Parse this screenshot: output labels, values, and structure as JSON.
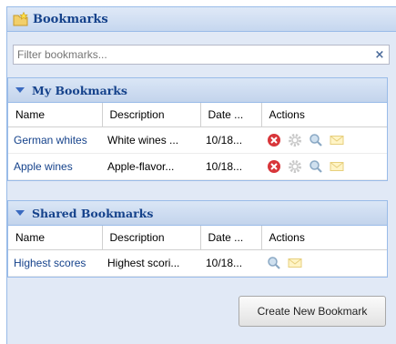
{
  "panel": {
    "title": "Bookmarks"
  },
  "filter": {
    "placeholder": "Filter bookmarks...",
    "value": "",
    "clear_label": "×"
  },
  "columns": {
    "name": "Name",
    "description": "Description",
    "date": "Date ...",
    "actions": "Actions"
  },
  "my_bookmarks": {
    "title": "My Bookmarks",
    "rows": [
      {
        "name": "German whites",
        "description": "White wines ...",
        "date": "10/18..."
      },
      {
        "name": "Apple wines",
        "description": "Apple-flavor...",
        "date": "10/18..."
      }
    ]
  },
  "shared_bookmarks": {
    "title": "Shared Bookmarks",
    "rows": [
      {
        "name": "Highest scores",
        "description": "Highest scori...",
        "date": "10/18..."
      }
    ]
  },
  "create_button": {
    "label": "Create New Bookmark"
  },
  "icons": {
    "folder": "folder-star-icon",
    "delete": "delete-icon",
    "settings": "gear-icon",
    "search": "magnifier-icon",
    "email": "email-icon"
  },
  "colors": {
    "accent": "#15428b",
    "panel_bg": "#e1e9f6",
    "border": "#99bbe8"
  }
}
